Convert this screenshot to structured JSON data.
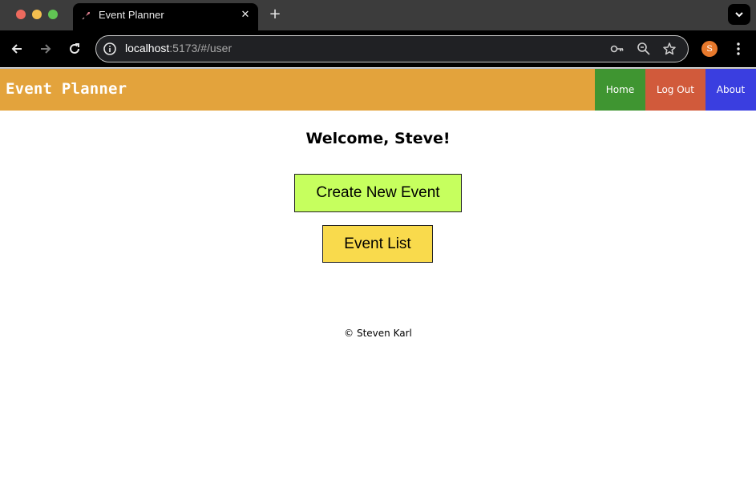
{
  "browser": {
    "tab": {
      "title": "Event Planner",
      "close_glyph": "✕"
    },
    "new_tab_glyph": "+",
    "url": {
      "host": "localhost",
      "path": ":5173/#/user"
    },
    "profile_initial": "S",
    "icons": [
      "back-arrow-icon",
      "forward-arrow-icon",
      "reload-icon",
      "site-info-icon",
      "key-icon",
      "zoom-icon",
      "star-icon",
      "kebab-menu-icon",
      "tab-search-icon"
    ],
    "colors": {
      "tab_bar": "#3c3c3c",
      "toolbar": "#000000",
      "profile": "#e8792c"
    }
  },
  "header": {
    "brand": "Event Planner",
    "nav": {
      "home": "Home",
      "logout": "Log Out",
      "about": "About"
    },
    "colors": {
      "bar": "#e3a33c",
      "home": "#3f9531",
      "logout": "#d15a3b",
      "about": "#3a3ee0"
    }
  },
  "main": {
    "welcome": "Welcome, Steve!",
    "create_button": "Create New Event",
    "list_button": "Event List",
    "colors": {
      "create": "#c6ff5e",
      "list": "#f9da4c"
    }
  },
  "footer": {
    "text": "© Steven Karl"
  }
}
